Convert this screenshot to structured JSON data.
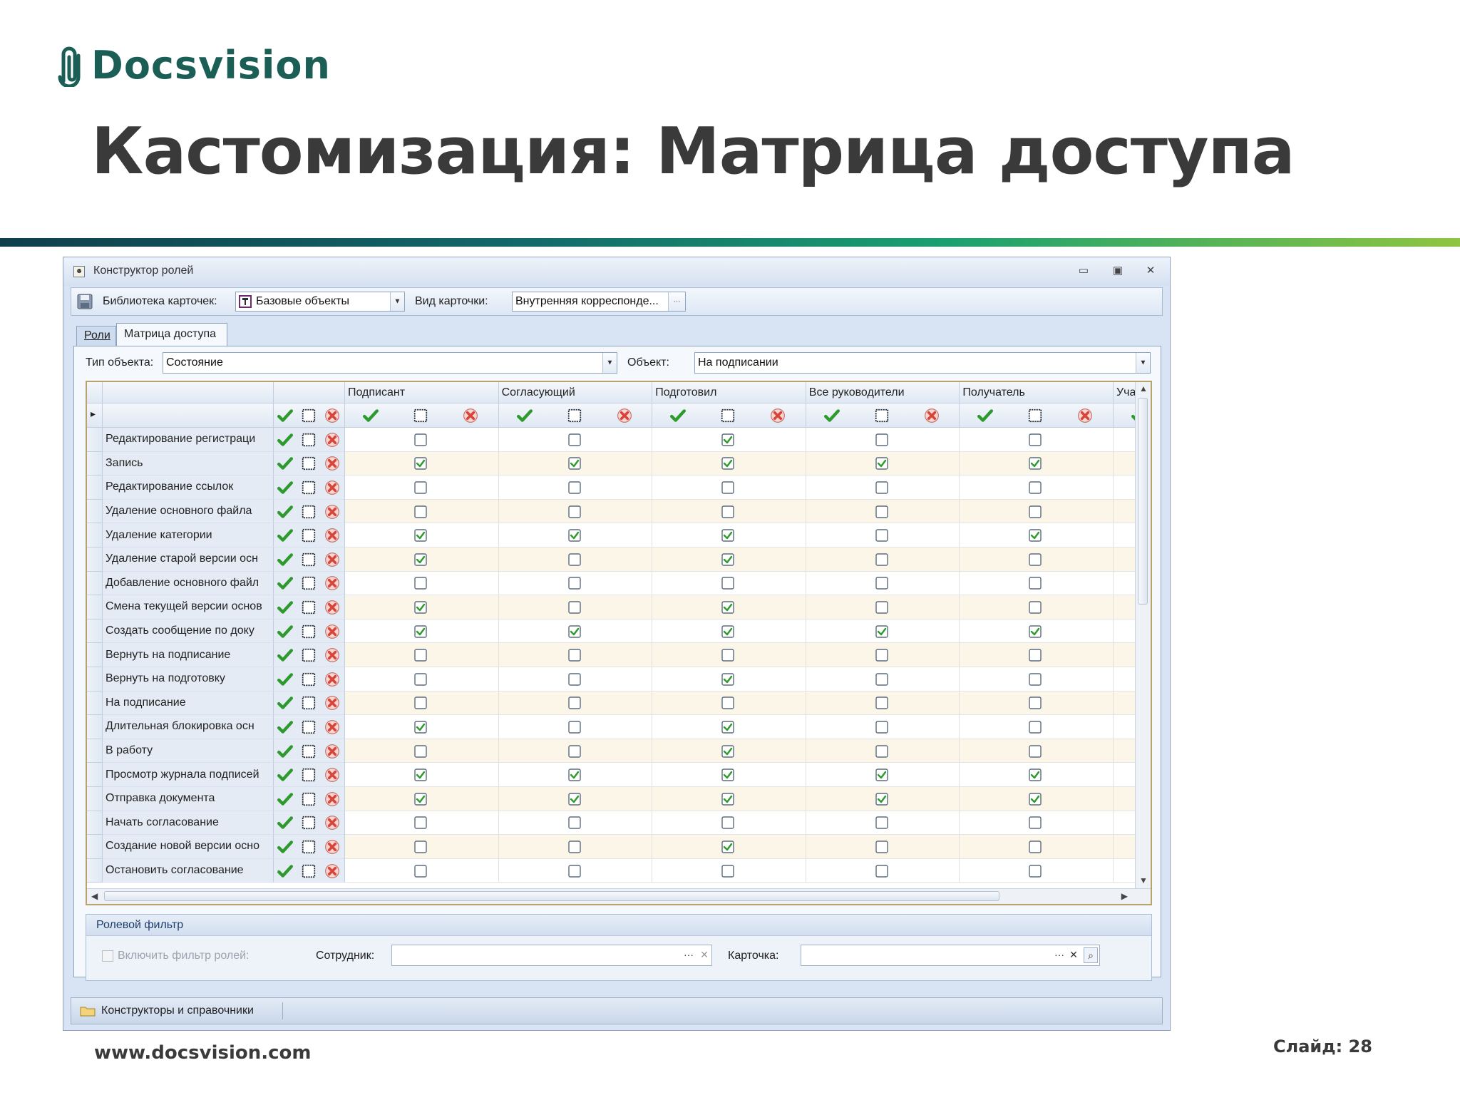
{
  "slide": {
    "logo_text": "Docsvision",
    "title": "Кастомизация: Матрица доступа",
    "footer_url": "www.docsvision.com",
    "slide_number": "Слайд: 28"
  },
  "window": {
    "title": "Конструктор ролей",
    "toolbar": {
      "library_label": "Библиотека карточек:",
      "library_value": "Базовые объекты",
      "card_type_label": "Вид карточки:",
      "card_type_value": "Внутренняя корреспонде..."
    },
    "tabs": [
      "Роли",
      "Матрица доступа"
    ],
    "active_tab": "Матрица доступа",
    "object_type_label": "Тип объекта:",
    "object_type_value": "Состояние",
    "object_label": "Объект:",
    "object_value": "На подписании",
    "grid": {
      "roles": [
        "Подписант",
        "Согласующий",
        "Подготовил",
        "Все руководители",
        "Получатель",
        "Учас"
      ],
      "rows": [
        {
          "name": "Редактирование регистраци",
          "checked": [
            false,
            false,
            true,
            false,
            false
          ]
        },
        {
          "name": "Запись",
          "checked": [
            true,
            true,
            true,
            true,
            true
          ]
        },
        {
          "name": "Редактирование ссылок",
          "checked": [
            false,
            false,
            false,
            false,
            false
          ]
        },
        {
          "name": "Удаление основного файла",
          "checked": [
            false,
            false,
            false,
            false,
            false
          ]
        },
        {
          "name": "Удаление категории",
          "checked": [
            true,
            true,
            true,
            false,
            true
          ]
        },
        {
          "name": "Удаление старой версии осн",
          "checked": [
            true,
            false,
            true,
            false,
            false
          ]
        },
        {
          "name": "Добавление основного файл",
          "checked": [
            false,
            false,
            false,
            false,
            false
          ]
        },
        {
          "name": "Смена текущей версии основ",
          "checked": [
            true,
            false,
            true,
            false,
            false
          ]
        },
        {
          "name": "Создать сообщение по доку",
          "checked": [
            true,
            true,
            true,
            true,
            true
          ]
        },
        {
          "name": "Вернуть на подписание",
          "checked": [
            false,
            false,
            false,
            false,
            false
          ]
        },
        {
          "name": "Вернуть на подготовку",
          "checked": [
            false,
            false,
            true,
            false,
            false
          ]
        },
        {
          "name": "На подписание",
          "checked": [
            false,
            false,
            false,
            false,
            false
          ]
        },
        {
          "name": "Длительная блокировка осн",
          "checked": [
            true,
            false,
            true,
            false,
            false
          ]
        },
        {
          "name": "В работу",
          "checked": [
            false,
            false,
            true,
            false,
            false
          ]
        },
        {
          "name": "Просмотр журнала подписей",
          "checked": [
            true,
            true,
            true,
            true,
            true
          ]
        },
        {
          "name": "Отправка документа",
          "checked": [
            true,
            true,
            true,
            true,
            true
          ]
        },
        {
          "name": "Начать согласование",
          "checked": [
            false,
            false,
            false,
            false,
            false
          ]
        },
        {
          "name": "Создание новой версии осно",
          "checked": [
            false,
            false,
            true,
            false,
            false
          ]
        },
        {
          "name": "Остановить согласование",
          "checked": [
            false,
            false,
            false,
            false,
            false
          ]
        }
      ]
    },
    "role_filter": {
      "title": "Ролевой фильтр",
      "enable_label": "Включить фильтр ролей:",
      "employee_label": "Сотрудник:",
      "card_label": "Карточка:"
    },
    "statusbar": {
      "item": "Конструкторы и справочники"
    }
  },
  "colors": {
    "logo": "#1b5e56",
    "check_green": "#2e9a2e",
    "cross_red": "#d8433a",
    "grid_border": "#b8a36a",
    "row_alt": "#fcf6e8"
  },
  "icons": {
    "allow": "green-check-icon",
    "neutral": "empty-square-icon",
    "deny": "red-cross-icon"
  }
}
